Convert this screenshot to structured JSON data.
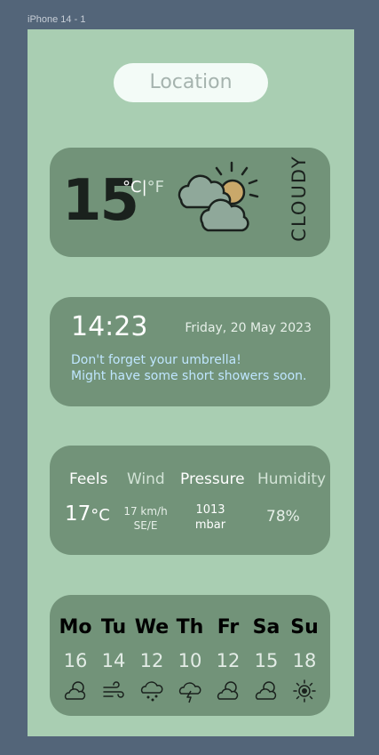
{
  "frame": {
    "label": "iPhone 14 - 1"
  },
  "location": {
    "label": "Location"
  },
  "current": {
    "temperature": "15",
    "unit_c": "°C",
    "unit_sep": "|",
    "unit_f": "°F",
    "condition": "CLOUDY",
    "icon": "partly-cloudy-icon"
  },
  "clock": {
    "time": "14:23",
    "date": "Friday, 20 May 2023",
    "message_line1": "Don't forget your umbrella!",
    "message_line2": "Might have some short showers soon."
  },
  "stats": {
    "feels_label": "Feels",
    "wind_label": "Wind",
    "pressure_label": "Pressure",
    "humidity_label": "Humidity",
    "feels_value": "17",
    "feels_unit": "°C",
    "wind_speed": "17 km/h",
    "wind_direction": "SE/E",
    "pressure_value": "1013",
    "pressure_unit": "mbar",
    "humidity_value": "78%"
  },
  "forecast": [
    {
      "day": "Mo",
      "temp": "16",
      "icon": "partly-cloudy-icon"
    },
    {
      "day": "Tu",
      "temp": "14",
      "icon": "wind-icon"
    },
    {
      "day": "We",
      "temp": "12",
      "icon": "rain-cloud-icon"
    },
    {
      "day": "Th",
      "temp": "10",
      "icon": "thunder-cloud-icon"
    },
    {
      "day": "Fr",
      "temp": "12",
      "icon": "partly-cloudy-icon"
    },
    {
      "day": "Sa",
      "temp": "15",
      "icon": "partly-cloudy-icon"
    },
    {
      "day": "Su",
      "temp": "18",
      "icon": "sun-icon"
    }
  ],
  "colors": {
    "background": "#536579",
    "frame": "#a9ceb2",
    "card": "#729379",
    "sun": "#c9a86a",
    "cloud": "#8fa89a",
    "message": "#bfe6ff"
  }
}
